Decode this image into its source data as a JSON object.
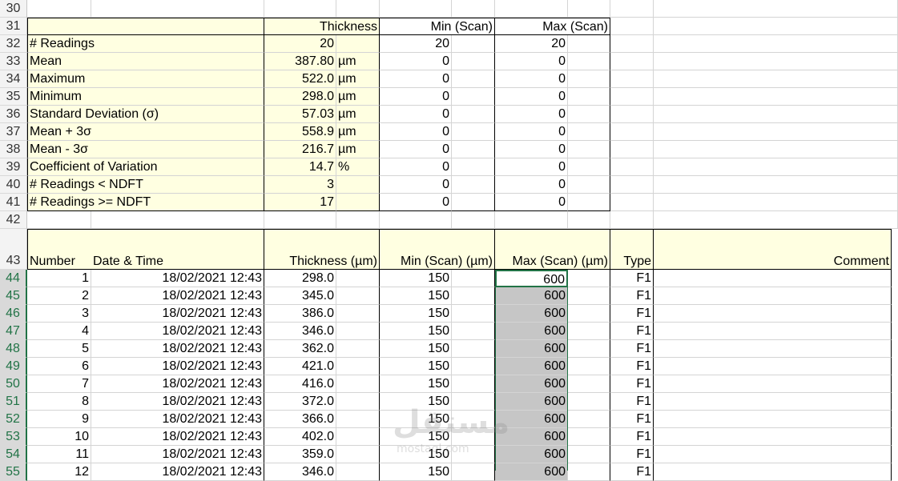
{
  "summary": {
    "headers": {
      "thickness": "Thickness",
      "min_scan": "Min (Scan)",
      "max_scan": "Max (Scan)"
    },
    "rows": [
      {
        "row": "32",
        "label": "# Readings",
        "thickness": "20",
        "unit": "",
        "min": "20",
        "max": "20"
      },
      {
        "row": "33",
        "label": "Mean",
        "thickness": "387.80",
        "unit": "µm",
        "min": "0",
        "max": "0"
      },
      {
        "row": "34",
        "label": "Maximum",
        "thickness": "522.0",
        "unit": "µm",
        "min": "0",
        "max": "0"
      },
      {
        "row": "35",
        "label": "Minimum",
        "thickness": "298.0",
        "unit": "µm",
        "min": "0",
        "max": "0"
      },
      {
        "row": "36",
        "label": "Standard Deviation (σ)",
        "thickness": "57.03",
        "unit": "µm",
        "min": "0",
        "max": "0"
      },
      {
        "row": "37",
        "label": "Mean + 3σ",
        "thickness": "558.9",
        "unit": "µm",
        "min": "0",
        "max": "0"
      },
      {
        "row": "38",
        "label": "Mean - 3σ",
        "thickness": "216.7",
        "unit": "µm",
        "min": "0",
        "max": "0"
      },
      {
        "row": "39",
        "label": "Coefficient of Variation",
        "thickness": "14.7",
        "unit": "%",
        "min": "0",
        "max": "0"
      },
      {
        "row": "40",
        "label": "# Readings < NDFT",
        "thickness": "3",
        "unit": "",
        "min": "0",
        "max": "0"
      },
      {
        "row": "41",
        "label": "# Readings >= NDFT",
        "thickness": "17",
        "unit": "",
        "min": "0",
        "max": "0"
      }
    ]
  },
  "row_numbers": {
    "r30": "30",
    "r31": "31",
    "r42": "42",
    "r43": "43"
  },
  "readings": {
    "headers": {
      "number": "Number",
      "datetime": "Date & Time",
      "thickness": "Thickness (µm)",
      "min_scan": "Min (Scan) (µm)",
      "max_scan": "Max (Scan) (µm)",
      "type": "Type",
      "comment": "Comment"
    },
    "rows": [
      {
        "row": "44",
        "number": "1",
        "datetime": "18/02/2021 12:43",
        "thickness": "298.0",
        "min": "150",
        "max": "600",
        "type": "F1"
      },
      {
        "row": "45",
        "number": "2",
        "datetime": "18/02/2021 12:43",
        "thickness": "345.0",
        "min": "150",
        "max": "600",
        "type": "F1"
      },
      {
        "row": "46",
        "number": "3",
        "datetime": "18/02/2021 12:43",
        "thickness": "386.0",
        "min": "150",
        "max": "600",
        "type": "F1"
      },
      {
        "row": "47",
        "number": "4",
        "datetime": "18/02/2021 12:43",
        "thickness": "346.0",
        "min": "150",
        "max": "600",
        "type": "F1"
      },
      {
        "row": "48",
        "number": "5",
        "datetime": "18/02/2021 12:43",
        "thickness": "362.0",
        "min": "150",
        "max": "600",
        "type": "F1"
      },
      {
        "row": "49",
        "number": "6",
        "datetime": "18/02/2021 12:43",
        "thickness": "421.0",
        "min": "150",
        "max": "600",
        "type": "F1"
      },
      {
        "row": "50",
        "number": "7",
        "datetime": "18/02/2021 12:43",
        "thickness": "416.0",
        "min": "150",
        "max": "600",
        "type": "F1"
      },
      {
        "row": "51",
        "number": "8",
        "datetime": "18/02/2021 12:43",
        "thickness": "372.0",
        "min": "150",
        "max": "600",
        "type": "F1"
      },
      {
        "row": "52",
        "number": "9",
        "datetime": "18/02/2021 12:43",
        "thickness": "366.0",
        "min": "150",
        "max": "600",
        "type": "F1"
      },
      {
        "row": "53",
        "number": "10",
        "datetime": "18/02/2021 12:43",
        "thickness": "402.0",
        "min": "150",
        "max": "600",
        "type": "F1"
      },
      {
        "row": "54",
        "number": "11",
        "datetime": "18/02/2021 12:43",
        "thickness": "359.0",
        "min": "150",
        "max": "600",
        "type": "F1"
      },
      {
        "row": "55",
        "number": "12",
        "datetime": "18/02/2021 12:43",
        "thickness": "346.0",
        "min": "150",
        "max": "600",
        "type": "F1"
      }
    ]
  },
  "watermark": {
    "arabic": "مستقل",
    "latin": "mostaql.com"
  },
  "colors": {
    "selection": "#217346",
    "note_fill": "#ffffe1",
    "selected_fill": "#c6c6c6"
  }
}
